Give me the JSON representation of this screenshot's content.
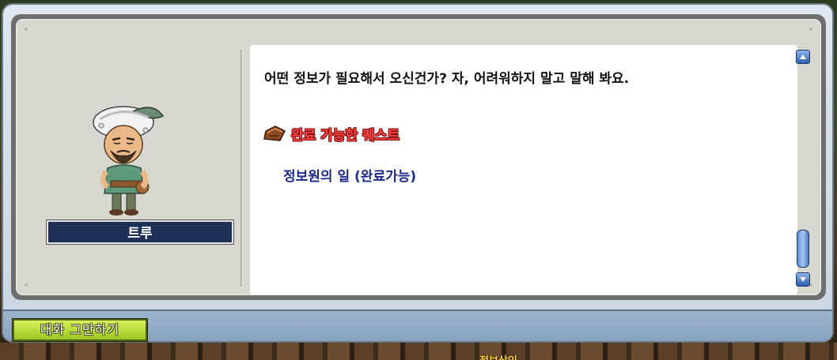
{
  "npc": {
    "name": "트루"
  },
  "dialog": {
    "text": "어떤 정보가 필요해서 오신건가? 자, 어려워하지 말고 말해 봐요.",
    "quest_section_title": "완료 가능한 퀘스트",
    "quest_items": [
      "정보원의 일 (완료가능)"
    ]
  },
  "buttons": {
    "end_chat": "대화 그만하기"
  },
  "map": {
    "label": "정보상인"
  },
  "icons": {
    "quest_book": "quest-book-icon",
    "scroll_up": "arrow-up-icon",
    "scroll_down": "arrow-down-icon"
  },
  "colors": {
    "quest_header": "#ff4545",
    "quest_item": "#1d2a8a",
    "name_plate": "#1f3156",
    "end_button": "#b8dc34"
  }
}
